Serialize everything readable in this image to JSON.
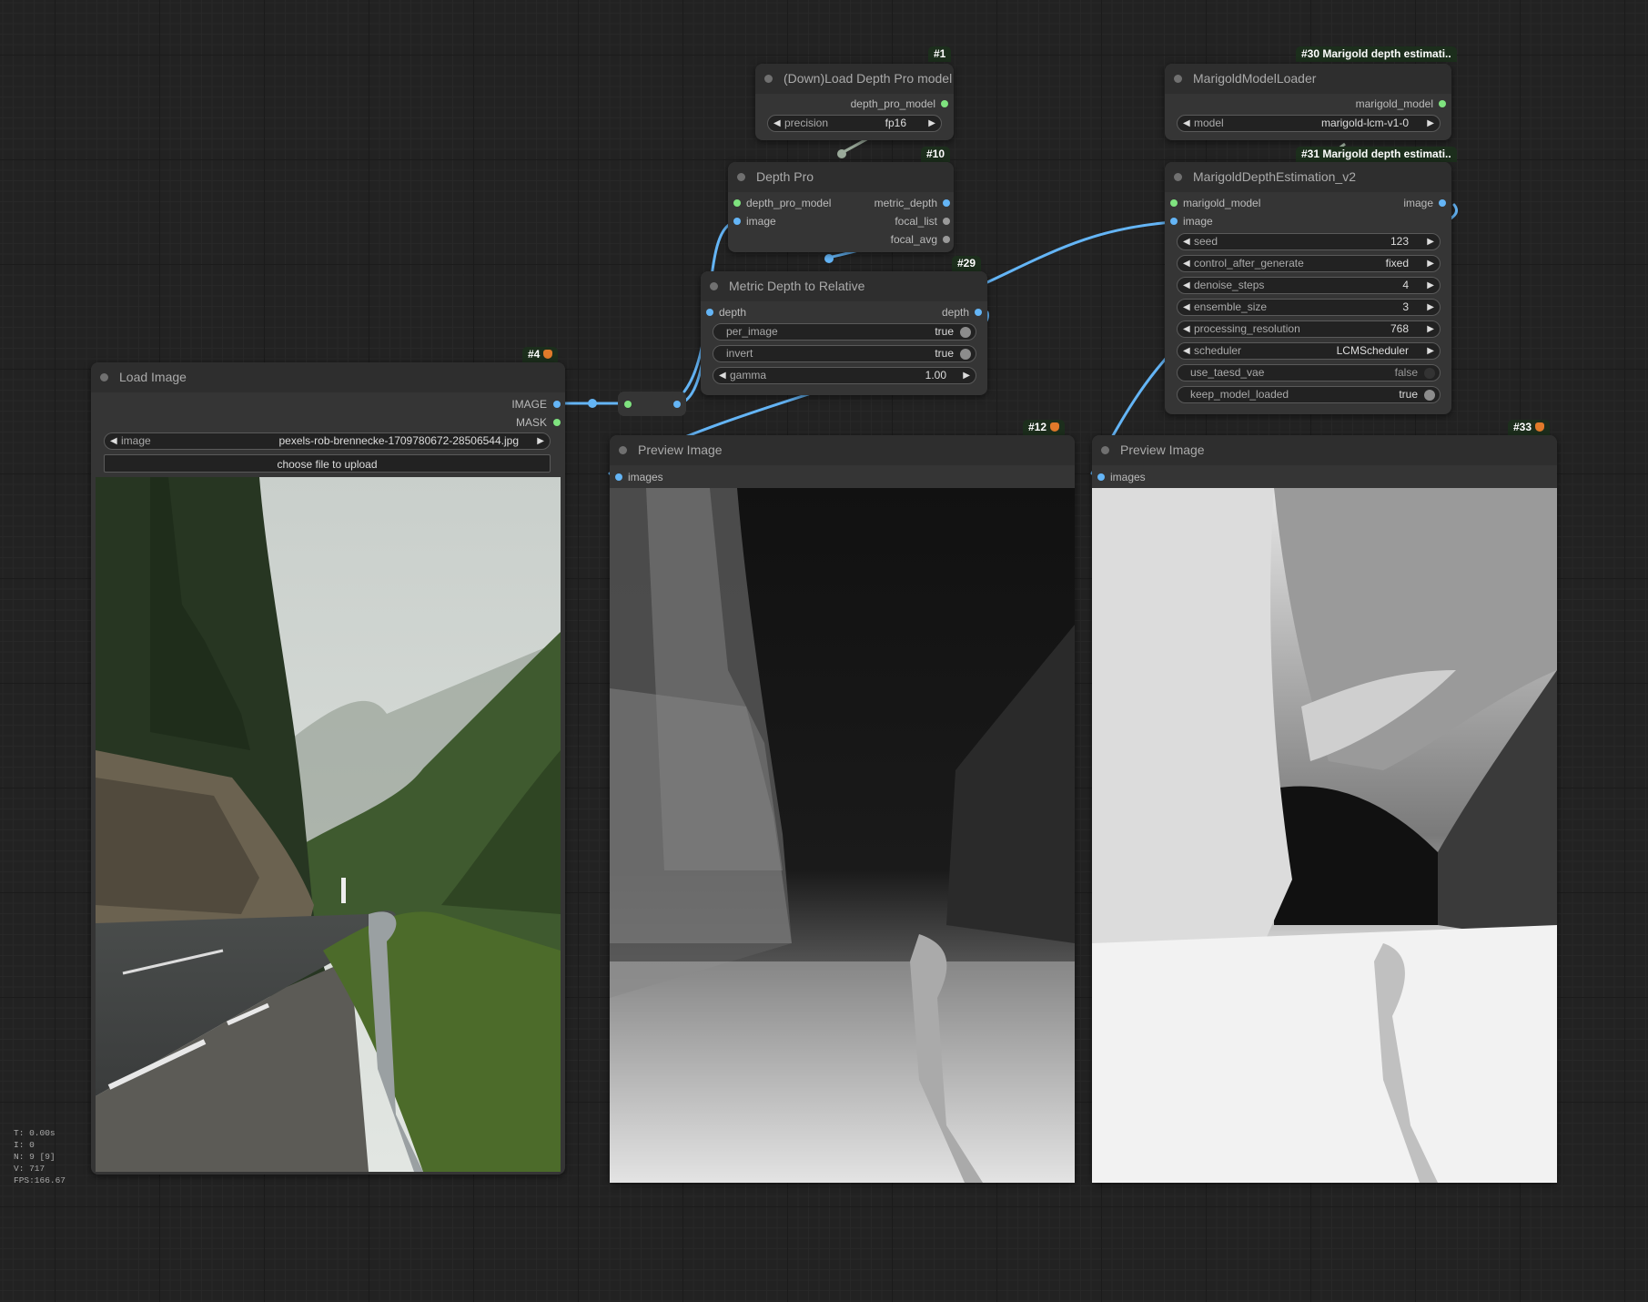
{
  "nodes": {
    "load_depth_pro": {
      "badge": "#1",
      "title": "(Down)Load Depth Pro model",
      "output": "depth_pro_model",
      "widget": {
        "label": "precision",
        "value": "fp16"
      }
    },
    "depth_pro": {
      "badge": "#10",
      "title": "Depth Pro",
      "inputs": [
        "depth_pro_model",
        "image"
      ],
      "outputs": [
        "metric_depth",
        "focal_list",
        "focal_avg"
      ]
    },
    "metric_to_relative": {
      "badge": "#29",
      "title": "Metric Depth to Relative",
      "input": "depth",
      "output": "depth",
      "widgets": [
        {
          "label": "per_image",
          "value": "true"
        },
        {
          "label": "invert",
          "value": "true"
        },
        {
          "label": "gamma",
          "value": "1.00"
        }
      ]
    },
    "marigold_loader": {
      "badge": "#30 Marigold depth estimati..",
      "title": "MarigoldModelLoader",
      "output": "marigold_model",
      "widget": {
        "label": "model",
        "value": "marigold-lcm-v1-0"
      }
    },
    "marigold_estimation": {
      "badge": "#31 Marigold depth estimati..",
      "title": "MarigoldDepthEstimation_v2",
      "inputs": [
        "marigold_model",
        "image"
      ],
      "output": "image",
      "widgets": [
        {
          "label": "seed",
          "value": "123"
        },
        {
          "label": "control_after_generate",
          "value": "fixed"
        },
        {
          "label": "denoise_steps",
          "value": "4"
        },
        {
          "label": "ensemble_size",
          "value": "3"
        },
        {
          "label": "processing_resolution",
          "value": "768"
        },
        {
          "label": "scheduler",
          "value": "LCMScheduler"
        }
      ],
      "toggles": [
        {
          "label": "use_taesd_vae",
          "value": "false"
        },
        {
          "label": "keep_model_loaded",
          "value": "true"
        }
      ]
    },
    "load_image": {
      "badge": "#4",
      "title": "Load Image",
      "outputs": [
        "IMAGE",
        "MASK"
      ],
      "widget": {
        "label": "image",
        "value": "pexels-rob-brennecke-1709780672-28506544.jpg"
      },
      "upload_label": "choose file to upload"
    },
    "preview_12": {
      "badge": "#12",
      "title": "Preview Image",
      "input": "images"
    },
    "preview_33": {
      "badge": "#33",
      "title": "Preview Image",
      "input": "images"
    }
  },
  "stats": [
    "T: 0.00s",
    "I: 0",
    "N: 9 [9]",
    "V: 717",
    "FPS:166.67"
  ],
  "colors": {
    "canvas": "#222222",
    "node_body": "#353535",
    "node_title": "#2e2e2e",
    "image_link": "#64b5f6",
    "model_link": "#7fe37f"
  }
}
